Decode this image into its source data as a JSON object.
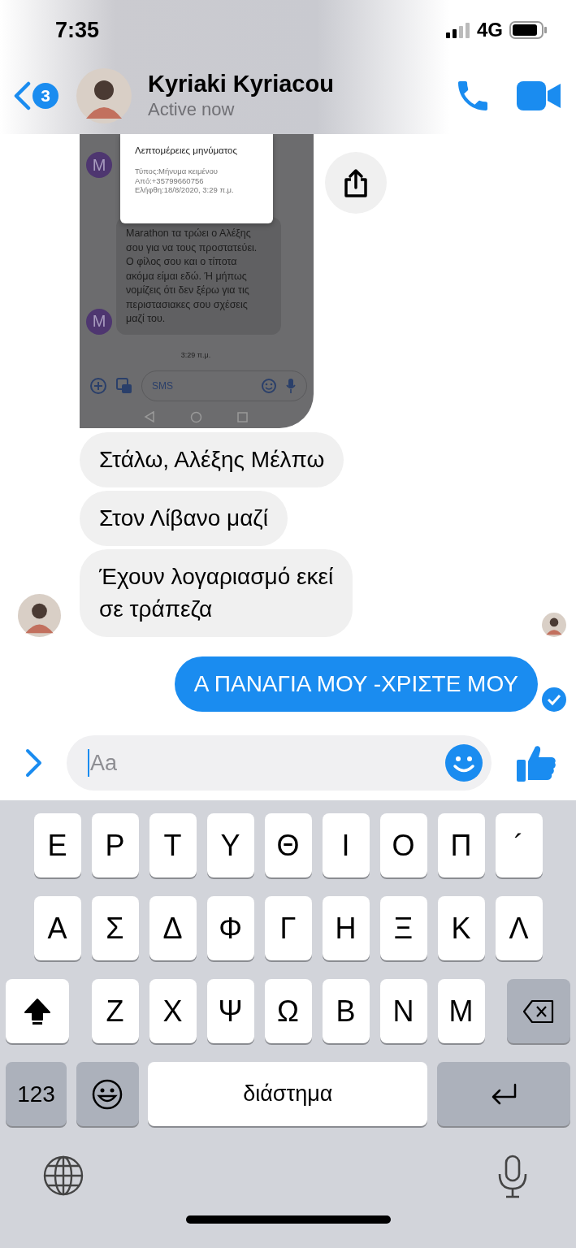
{
  "status_bar": {
    "time": "7:35",
    "network": "4G"
  },
  "header": {
    "back_badge": "3",
    "name": "Kyriaki Kyriacou",
    "status": "Active now"
  },
  "shared_screenshot": {
    "popup": {
      "title": "Λεπτομέρειες μηνύματος",
      "lines": [
        "Τύπος:Μήνυμα κειμένου",
        "Από:+35799660756",
        "Ελήφθη:18/8/2020, 3:29 π.μ."
      ]
    },
    "avatar_letters": [
      "M",
      "M"
    ],
    "message_lines": [
      "Marathon τα τρώει ο Αλέξης",
      "σου για να τους προστατεύει.",
      "Ο φίλος σου και ο τίποτα",
      "ακόμα είμαι εδώ. Ή μήπως",
      "νομίζεις ότι δεν ξέρω για τις",
      "περιστασιακες σου σχέσεις",
      "μαζί του."
    ],
    "time": "3:29 π.μ.",
    "input_placeholder": "SMS"
  },
  "messages": [
    {
      "kind": "received",
      "text": "Στάλω, Αλέξης Μέλπω",
      "avatar": false,
      "read_marker": false
    },
    {
      "kind": "received",
      "text": "Στον Λίβανο μαζί",
      "avatar": false,
      "read_marker": false
    },
    {
      "kind": "received",
      "text": "Έχουν λογαριασμό εκεί\nσε τράπεζα",
      "avatar": true,
      "read_marker": true
    },
    {
      "kind": "sent",
      "text": "Α ΠΑΝΑΓΙΑ ΜΟΥ -ΧΡΙΣΤΕ ΜΟΥ",
      "seen": true
    }
  ],
  "composer": {
    "placeholder": "Aa"
  },
  "keyboard": {
    "rows": [
      {
        "keys": [
          "Ε",
          "Ρ",
          "Τ",
          "Υ",
          "Θ",
          "Ι",
          "Ο",
          "Π",
          "´"
        ]
      },
      {
        "keys": [
          "Α",
          "Σ",
          "Δ",
          "Φ",
          "Γ",
          "Η",
          "Ξ",
          "Κ",
          "Λ"
        ]
      },
      {
        "keys": [
          "Ζ",
          "Χ",
          "Ψ",
          "Ω",
          "Β",
          "Ν",
          "Μ"
        ]
      }
    ],
    "shift_on": true,
    "numbers_key": "123",
    "space_key": "διάστημα"
  }
}
